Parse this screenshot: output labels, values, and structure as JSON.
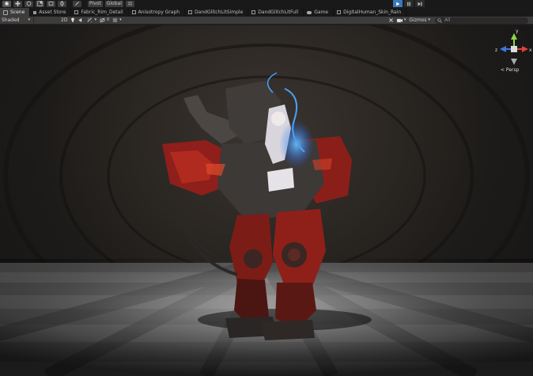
{
  "toolbar": {
    "pivot_label": "Pivot",
    "global_label": "Global",
    "tools": [
      "hand-tool",
      "move-tool",
      "rotate-tool",
      "scale-tool",
      "rect-tool",
      "transform-tool",
      "custom-tool"
    ],
    "play": [
      "play",
      "pause",
      "step"
    ],
    "play_active_color": "#3a79bb"
  },
  "tabs": [
    {
      "label": "Scene",
      "icon": "scene-icon",
      "active": true
    },
    {
      "label": "Asset Store",
      "icon": "store-icon",
      "active": false
    },
    {
      "label": "Fabric_Rim_Detail",
      "icon": "graph-icon",
      "active": false
    },
    {
      "label": "Anisotropy Graph",
      "icon": "graph-icon",
      "active": false
    },
    {
      "label": "DandGlitchLitSimple",
      "icon": "graph-icon",
      "active": false
    },
    {
      "label": "DandGlitchLitFull",
      "icon": "graph-icon",
      "active": false
    },
    {
      "label": "Game",
      "icon": "game-icon",
      "active": false
    },
    {
      "label": "DigitalHuman_Skin_Rain",
      "icon": "graph-icon",
      "active": false
    }
  ],
  "scene_toolbar": {
    "shading_mode": "Shaded",
    "mode_2d": "2D",
    "gizmos_label": "Gizmos",
    "search_placeholder": "All"
  },
  "gizmo": {
    "projection_label": "< Persp",
    "axis_x": "x",
    "axis_y": "y",
    "axis_z": "z",
    "colors": {
      "x": "#e0413a",
      "y": "#8cd64a",
      "z": "#3d76e0"
    }
  }
}
